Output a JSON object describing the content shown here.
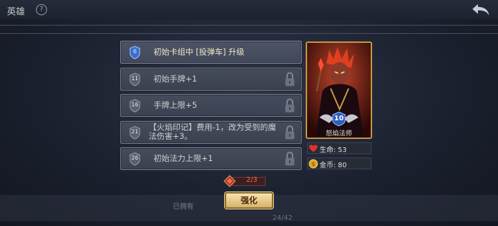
{
  "topbar": {
    "title": "英雄",
    "help_icon": "?"
  },
  "upgrades": [
    {
      "level": "6",
      "text": "初始卡组中 [投弹车] 升级",
      "locked": false
    },
    {
      "level": "11",
      "text": "初始手牌+1",
      "locked": true
    },
    {
      "level": "16",
      "text": "手牌上限+5",
      "locked": true
    },
    {
      "level": "21",
      "text": "【火焰印记】费用-1，改为受到的魔法伤害+3。",
      "locked": true
    },
    {
      "level": "26",
      "text": "初始法力上限+1",
      "locked": true
    }
  ],
  "cost": {
    "text": "2/3"
  },
  "upgrade_button": {
    "label": "强化"
  },
  "owned_label": "已拥有",
  "page_count": "24/42",
  "hero": {
    "name": "怒焰法师",
    "level": "10",
    "hp": "生命: 53",
    "gold": "金币: 80"
  },
  "colors": {
    "accent_gold": "#c99a3e",
    "cost_red": "#ff6b4a",
    "badge_blue": "#3a6fd0"
  }
}
